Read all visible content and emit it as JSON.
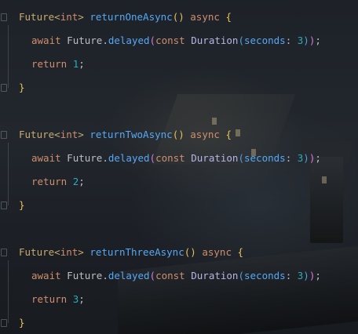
{
  "blocks": [
    {
      "signature": {
        "return_type": "Future",
        "type_open": "<",
        "type_arg": "int",
        "type_close": ">",
        "name": "returnOneAsync",
        "parens": "()",
        "modifier": "async",
        "open_brace": "{"
      },
      "await_line": {
        "keyword": "await",
        "target": "Future",
        "dot": ".",
        "method": "delayed",
        "lparen": "(",
        "const_kw": "const",
        "ctor": "Duration",
        "inner_lparen": "(",
        "param": "seconds",
        "colon": ":",
        "value": "3",
        "inner_rparen": ")",
        "rparen": ")",
        "semi": ";"
      },
      "return_line": {
        "keyword": "return",
        "value": "1",
        "semi": ";"
      },
      "close_brace": "}"
    },
    {
      "signature": {
        "return_type": "Future",
        "type_open": "<",
        "type_arg": "int",
        "type_close": ">",
        "name": "returnTwoAsync",
        "parens": "()",
        "modifier": "async",
        "open_brace": "{"
      },
      "await_line": {
        "keyword": "await",
        "target": "Future",
        "dot": ".",
        "method": "delayed",
        "lparen": "(",
        "const_kw": "const",
        "ctor": "Duration",
        "inner_lparen": "(",
        "param": "seconds",
        "colon": ":",
        "value": "3",
        "inner_rparen": ")",
        "rparen": ")",
        "semi": ";"
      },
      "return_line": {
        "keyword": "return",
        "value": "2",
        "semi": ";"
      },
      "close_brace": "}"
    },
    {
      "signature": {
        "return_type": "Future",
        "type_open": "<",
        "type_arg": "int",
        "type_close": ">",
        "name": "returnThreeAsync",
        "parens": "()",
        "modifier": "async",
        "open_brace": "{"
      },
      "await_line": {
        "keyword": "await",
        "target": "Future",
        "dot": ".",
        "method": "delayed",
        "lparen": "(",
        "const_kw": "const",
        "ctor": "Duration",
        "inner_lparen": "(",
        "param": "seconds",
        "colon": ":",
        "value": "3",
        "inner_rparen": ")",
        "rparen": ")",
        "semi": ";"
      },
      "return_line": {
        "keyword": "return",
        "value": "3",
        "semi": ";"
      },
      "close_brace": "}"
    }
  ],
  "colors": {
    "keyword": "#cf8e6d",
    "type": "#c8a96e",
    "function": "#56a8f5",
    "number": "#2aacb8",
    "text": "#bcbec4"
  }
}
